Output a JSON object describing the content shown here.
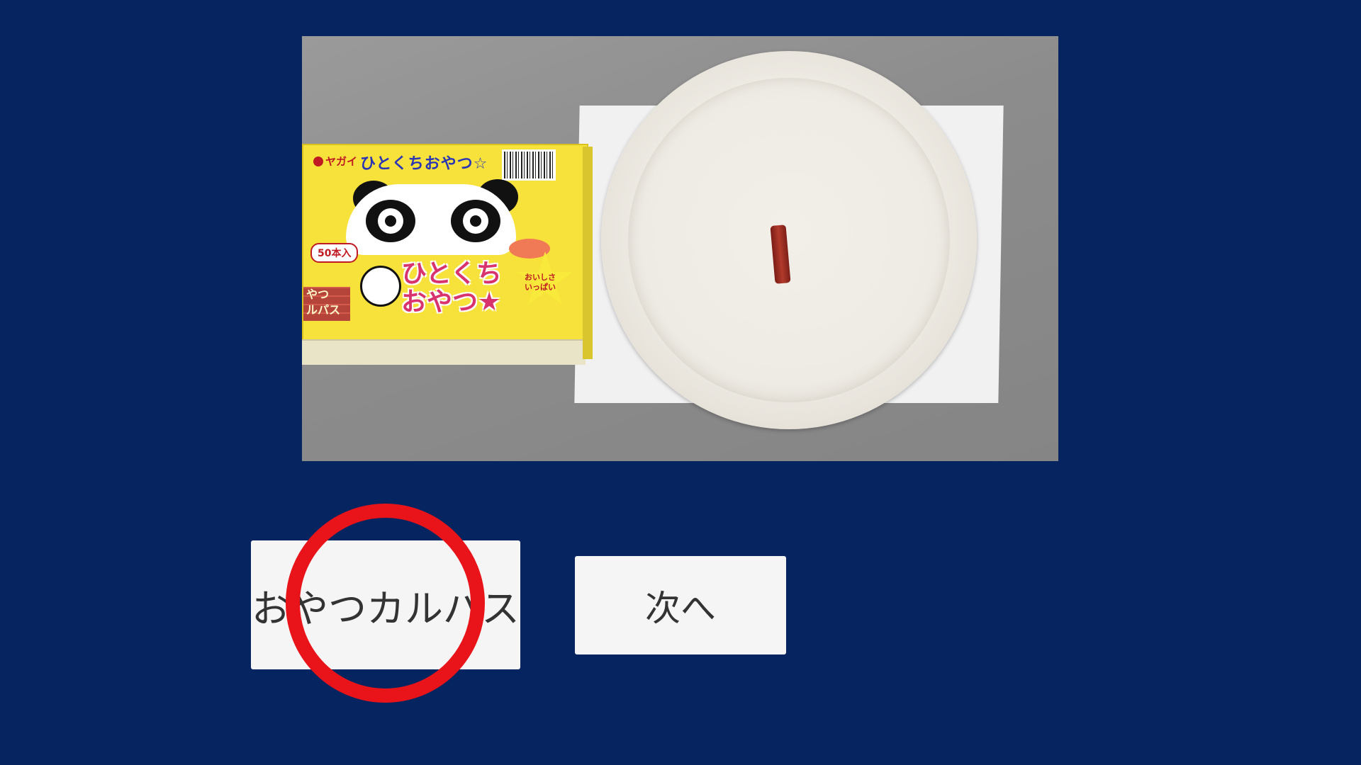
{
  "photo": {
    "box": {
      "brand": "ヤガイ",
      "title_small": "ひとくちおやつ☆",
      "count_badge": "50本入",
      "title_big_line1": "ひとくち",
      "title_big_line2": "おやつ★",
      "brick_label_line1": "やつ",
      "brick_label_line2": "ルパス",
      "star_text_line1": "おいしさ",
      "star_text_line2": "いっぱい"
    }
  },
  "buttons": {
    "choice_label": "おやつカルパス",
    "next_label": "次へ"
  },
  "feedback": {
    "mark": "correct-circle",
    "color": "#e8141a"
  },
  "colors": {
    "background": "#062560",
    "button_bg": "#f5f5f5"
  }
}
